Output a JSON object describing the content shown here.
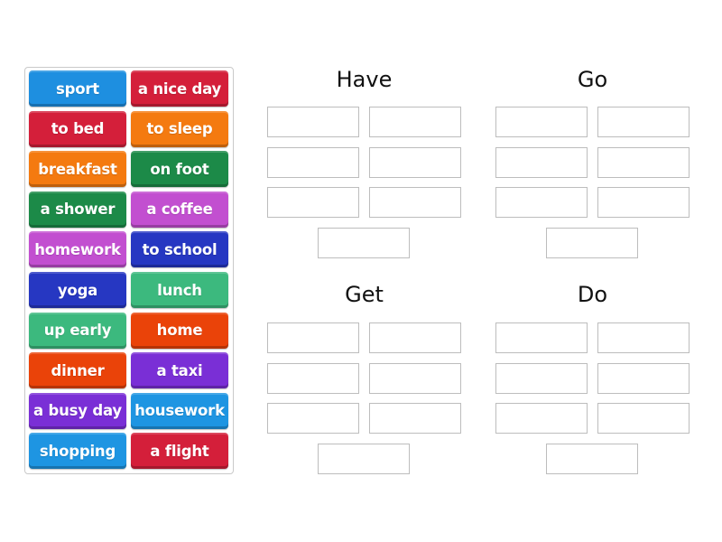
{
  "tiles": [
    {
      "label": "sport",
      "color": "#1e8fe0"
    },
    {
      "label": "a nice day",
      "color": "#d41f3a"
    },
    {
      "label": "to bed",
      "color": "#d41f3a"
    },
    {
      "label": "to sleep",
      "color": "#f47a10"
    },
    {
      "label": "breakfast",
      "color": "#f47a10"
    },
    {
      "label": "on foot",
      "color": "#1c8a48"
    },
    {
      "label": "a shower",
      "color": "#1c8a48"
    },
    {
      "label": "a coffee",
      "color": "#c24fd0"
    },
    {
      "label": "homework",
      "color": "#c24fd0"
    },
    {
      "label": "to school",
      "color": "#2637c2"
    },
    {
      "label": "yoga",
      "color": "#2637c2"
    },
    {
      "label": "lunch",
      "color": "#3cb97e"
    },
    {
      "label": "up early",
      "color": "#3cb97e"
    },
    {
      "label": "home",
      "color": "#ea4309"
    },
    {
      "label": "dinner",
      "color": "#ea4309"
    },
    {
      "label": "a taxi",
      "color": "#7a2fd6"
    },
    {
      "label": "a busy day",
      "color": "#7a2fd6"
    },
    {
      "label": "housework",
      "color": "#1e95e2"
    },
    {
      "label": "shopping",
      "color": "#1e95e2"
    },
    {
      "label": "a flight",
      "color": "#d41f3a"
    }
  ],
  "groups": [
    {
      "title": "Have",
      "slots": 7
    },
    {
      "title": "Go",
      "slots": 7
    },
    {
      "title": "Get",
      "slots": 7
    },
    {
      "title": "Do",
      "slots": 7
    }
  ]
}
